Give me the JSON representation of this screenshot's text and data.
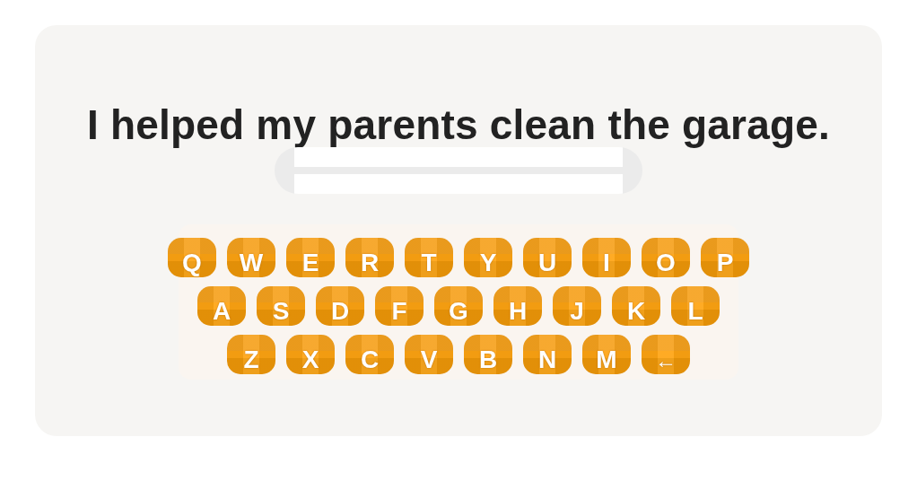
{
  "sentence": "I helped my parents clean the garage.",
  "keyboard": {
    "rows": [
      {
        "keys": [
          {
            "label": "Q",
            "kind": "letter"
          },
          {
            "label": "W",
            "kind": "letter"
          },
          {
            "label": "E",
            "kind": "letter"
          },
          {
            "label": "R",
            "kind": "letter"
          },
          {
            "label": "T",
            "kind": "letter"
          },
          {
            "label": "Y",
            "kind": "letter"
          },
          {
            "label": "U",
            "kind": "letter"
          },
          {
            "label": "I",
            "kind": "letter"
          },
          {
            "label": "O",
            "kind": "letter"
          },
          {
            "label": "P",
            "kind": "letter"
          }
        ]
      },
      {
        "keys": [
          {
            "label": "A",
            "kind": "letter"
          },
          {
            "label": "S",
            "kind": "letter"
          },
          {
            "label": "D",
            "kind": "letter"
          },
          {
            "label": "F",
            "kind": "letter"
          },
          {
            "label": "G",
            "kind": "letter"
          },
          {
            "label": "H",
            "kind": "letter"
          },
          {
            "label": "J",
            "kind": "letter"
          },
          {
            "label": "K",
            "kind": "letter"
          },
          {
            "label": "L",
            "kind": "letter"
          }
        ]
      },
      {
        "keys": [
          {
            "label": "Z",
            "kind": "letter"
          },
          {
            "label": "X",
            "kind": "letter"
          },
          {
            "label": "C",
            "kind": "letter"
          },
          {
            "label": "V",
            "kind": "letter"
          },
          {
            "label": "B",
            "kind": "letter"
          },
          {
            "label": "N",
            "kind": "letter"
          },
          {
            "label": "M",
            "kind": "letter"
          },
          {
            "label": "←",
            "kind": "backspace"
          }
        ]
      }
    ]
  }
}
